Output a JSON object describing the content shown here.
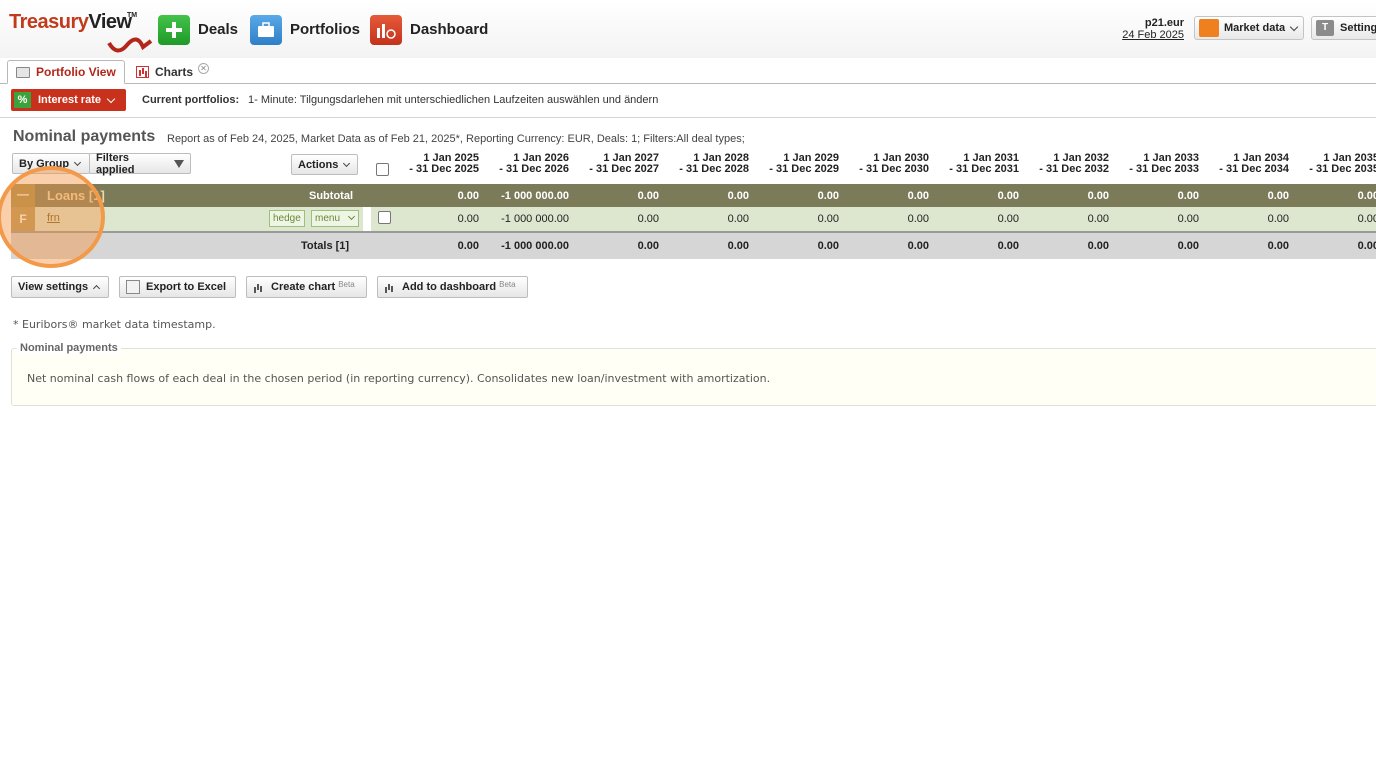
{
  "header": {
    "logo": "TreasuryView",
    "logo_tm": "TM",
    "nav": [
      {
        "label": "Deals",
        "icon": "plus-icon"
      },
      {
        "label": "Portfolios",
        "icon": "briefcase-icon"
      },
      {
        "label": "Dashboard",
        "icon": "dashboard-icon"
      }
    ],
    "user": "p21.eur",
    "date": "24 Feb 2025",
    "market_data_label": "Market data",
    "settings_label": "Setting"
  },
  "tabs": [
    {
      "label": "Portfolio View",
      "active": true
    },
    {
      "label": "Charts",
      "active": false
    }
  ],
  "toolbar": {
    "interest_rate_label": "Interest rate",
    "current_portfolios_label": "Current portfolios:",
    "current_portfolios_value": "1- Minute: Tilgungsdarlehen mit unterschiedlichen Laufzeiten auswählen und ändern"
  },
  "report": {
    "title": "Nominal payments",
    "subtitle": "Report as of Feb 24, 2025, Market Data as of Feb 21, 2025*, Reporting Currency: EUR, Deals: 1; Filters:All deal types;",
    "by_group_label": "By Group",
    "filters_label": "Filters applied",
    "actions_label": "Actions",
    "columns": [
      {
        "l1": "1 Jan 2025",
        "l2": "- 31 Dec 2025"
      },
      {
        "l1": "1 Jan 2026",
        "l2": "- 31 Dec 2026"
      },
      {
        "l1": "1 Jan 2027",
        "l2": "- 31 Dec 2027"
      },
      {
        "l1": "1 Jan 2028",
        "l2": "- 31 Dec 2028"
      },
      {
        "l1": "1 Jan 2029",
        "l2": "- 31 Dec 2029"
      },
      {
        "l1": "1 Jan 2030",
        "l2": "- 31 Dec 2030"
      },
      {
        "l1": "1 Jan 2031",
        "l2": "- 31 Dec 2031"
      },
      {
        "l1": "1 Jan 2032",
        "l2": "- 31 Dec 2032"
      },
      {
        "l1": "1 Jan 2033",
        "l2": "- 31 Dec 2033"
      },
      {
        "l1": "1 Jan 2034",
        "l2": "- 31 Dec 2034"
      },
      {
        "l1": "1 Jan 2035",
        "l2": "- 31 Dec 2035"
      }
    ],
    "group": {
      "collapse": "—",
      "name": "Loans [1]",
      "subtotal_label": "Subtotal",
      "values": [
        "0.00",
        "-1 000 000.00",
        "0.00",
        "0.00",
        "0.00",
        "0.00",
        "0.00",
        "0.00",
        "0.00",
        "0.00",
        "0.00"
      ]
    },
    "deal": {
      "type": "F",
      "name": "frn",
      "hedge_label": "hedge",
      "menu_label": "menu",
      "values": [
        "0.00",
        "-1 000 000.00",
        "0.00",
        "0.00",
        "0.00",
        "0.00",
        "0.00",
        "0.00",
        "0.00",
        "0.00",
        "0.00"
      ]
    },
    "totals": {
      "label": "Totals [1]",
      "values": [
        "0.00",
        "-1 000 000.00",
        "0.00",
        "0.00",
        "0.00",
        "0.00",
        "0.00",
        "0.00",
        "0.00",
        "0.00",
        "0.00"
      ]
    }
  },
  "actions": {
    "view_settings": "View settings",
    "export_excel": "Export to Excel",
    "create_chart": "Create chart",
    "add_dashboard": "Add to dashboard",
    "beta": "Beta"
  },
  "footnote": "* Euribors® market data timestamp.",
  "info": {
    "legend": "Nominal payments",
    "text": "Net nominal cash flows of each deal in the chosen period (in reporting currency). Consolidates new loan/investment with amortization."
  },
  "colors": {
    "brand": "#c23a1c",
    "group_row": "#7b7b5a",
    "deal_row": "#dde6cf",
    "highlight": "#f39a4a"
  }
}
